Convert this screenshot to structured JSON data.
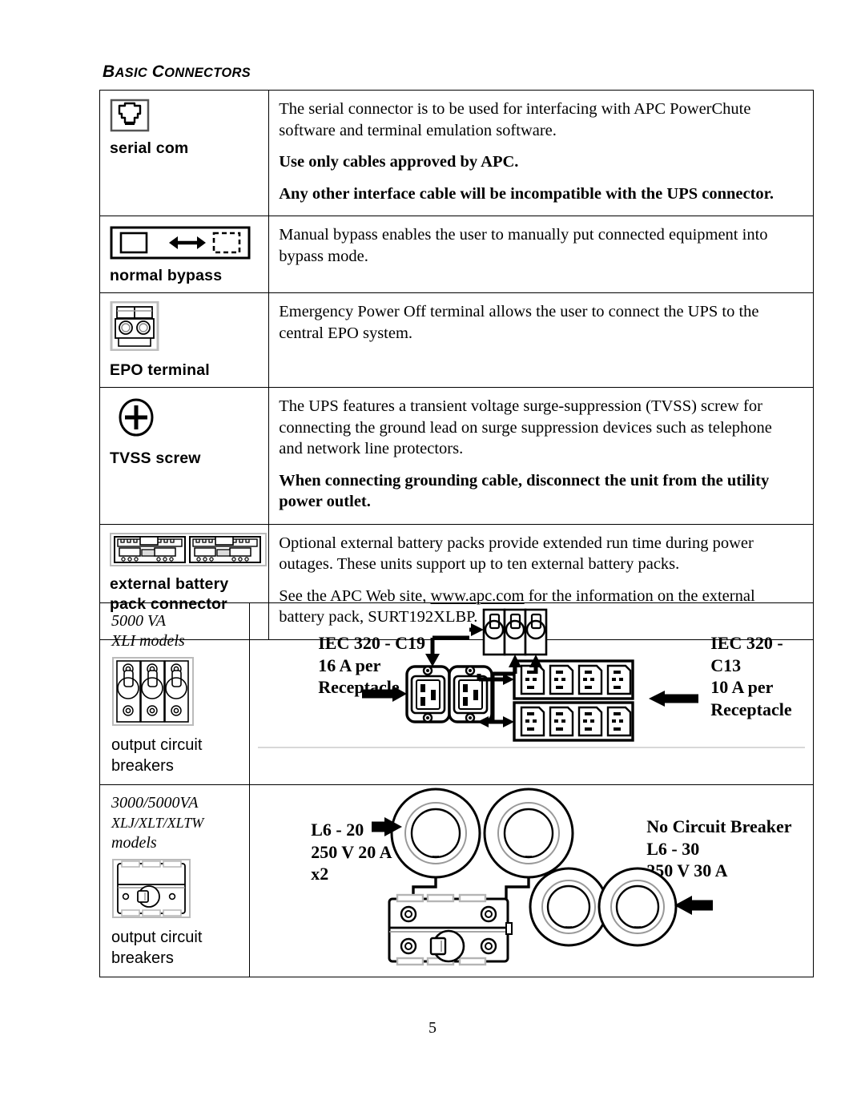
{
  "page": {
    "section_heading": "BASIC CONNECTORS",
    "page_number": "5"
  },
  "connectors_table": {
    "rows": [
      {
        "icon": "serial-com-icon",
        "label": "serial com",
        "paragraphs": [
          {
            "style": "regular",
            "text": "The serial connector is to be used for interfacing with APC PowerChute software and terminal emulation software."
          },
          {
            "style": "bold",
            "text": "Use only cables approved by APC."
          },
          {
            "style": "bold",
            "text": "Any other interface cable will be incompatible with the UPS connector."
          }
        ]
      },
      {
        "icon": "normal-bypass-icon",
        "label": "normal   bypass",
        "paragraphs": [
          {
            "style": "regular",
            "text": "Manual bypass enables the user to manually put connected equipment into bypass mode."
          }
        ]
      },
      {
        "icon": "epo-terminal-icon",
        "label": "EPO terminal",
        "paragraphs": [
          {
            "style": "regular",
            "text": "Emergency Power Off terminal allows the user to connect the UPS to the central EPO system."
          }
        ]
      },
      {
        "icon": "tvss-screw-icon",
        "label": "TVSS screw",
        "paragraphs": [
          {
            "style": "regular",
            "text": "The UPS features a transient voltage surge-suppression (TVSS) screw for connecting the ground lead on surge suppression devices such as telephone and network line protectors."
          },
          {
            "style": "bold",
            "text": "When connecting grounding cable, disconnect the unit from the utility power outlet."
          }
        ]
      },
      {
        "icon": "external-battery-pack-connector-icon",
        "label": "external battery pack connector",
        "paragraphs": [
          {
            "style": "regular",
            "text": "Optional external battery packs provide extended run time during power outages. These units support up to ten external battery packs."
          },
          {
            "style": "link",
            "text_before": "See the APC Web site, ",
            "link": "www.apc.com",
            "text_after": " for the information on the external battery pack, SURT192XLBP."
          }
        ]
      }
    ]
  },
  "receptacle_table": {
    "rows": [
      {
        "model_lines": [
          "5000 VA",
          "XLI models"
        ],
        "breaker_label": "output circuit breakers",
        "callouts": [
          {
            "name": "iec-c19-callout",
            "text": "IEC 320 - C19\n16 A per\nReceptacle"
          },
          {
            "name": "iec-c13-callout",
            "text": "IEC 320 - C13\n10 A per\nReceptacle"
          }
        ]
      },
      {
        "model_lines": [
          "3000/5000VA",
          "XLJ/XLT/XLTW",
          "models"
        ],
        "breaker_label": "output circuit breakers",
        "callouts": [
          {
            "name": "l6-20-callout",
            "text": "L6 - 20\n250 V 20 A\nx2"
          },
          {
            "name": "l6-30-callout",
            "text": "No Circuit Breaker\nL6 - 30\n250 V 30 A\nx2"
          }
        ]
      }
    ]
  }
}
